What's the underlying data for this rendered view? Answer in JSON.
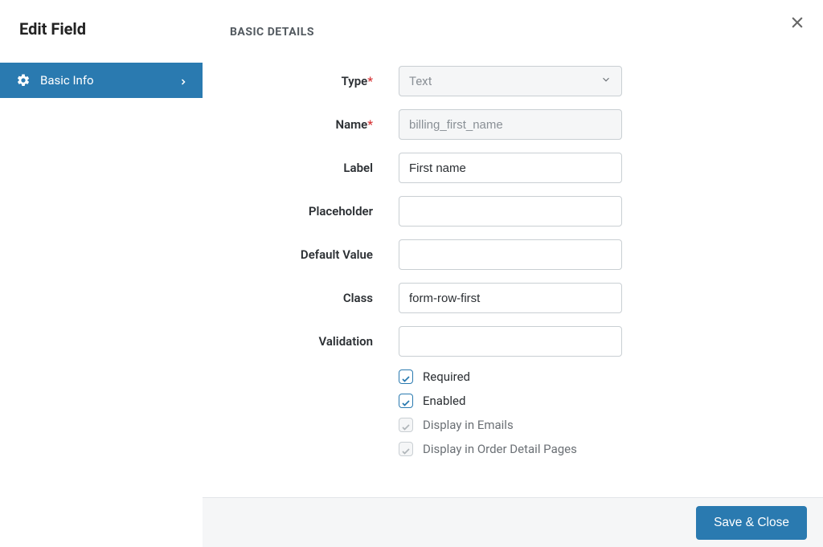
{
  "sidebar": {
    "title": "Edit Field",
    "item_label": "Basic Info"
  },
  "section_heading": "BASIC DETAILS",
  "labels": {
    "type": "Type",
    "name": "Name",
    "label": "Label",
    "placeholder": "Placeholder",
    "default_value": "Default Value",
    "class": "Class",
    "validation": "Validation"
  },
  "values": {
    "type": "Text",
    "name": "billing_first_name",
    "label": "First name",
    "placeholder": "",
    "default_value": "",
    "class": "form-row-first",
    "validation": ""
  },
  "checks": {
    "required": "Required",
    "enabled": "Enabled",
    "display_emails": "Display in Emails",
    "display_order_pages": "Display in Order Detail Pages"
  },
  "footer": {
    "save_label": "Save & Close"
  }
}
